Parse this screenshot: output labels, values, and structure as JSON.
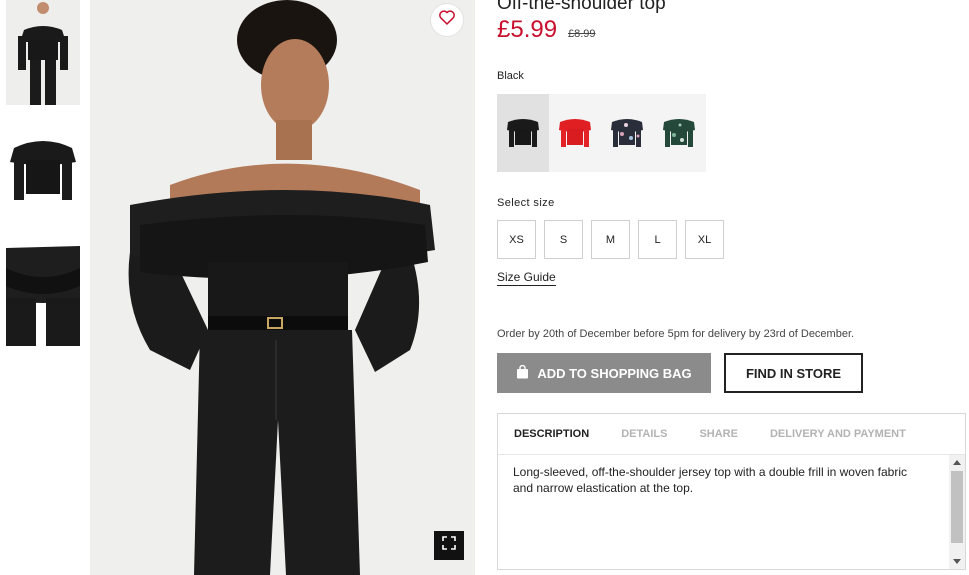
{
  "product": {
    "title": "Off-the-shoulder top",
    "price": "£5.99",
    "old_price": "£8.99",
    "color_label": "Black",
    "swatches": [
      {
        "name": "black",
        "color": "#1a1a1a"
      },
      {
        "name": "red",
        "color": "#e01f22"
      },
      {
        "name": "floral-print",
        "color": "#2a2e3a"
      },
      {
        "name": "green-print",
        "color": "#24483a"
      }
    ],
    "size_label": "Select size",
    "sizes": [
      "XS",
      "S",
      "M",
      "L",
      "XL"
    ],
    "size_guide": "Size Guide",
    "delivery_note": "Order by 20th of December before 5pm for delivery by 23rd of December.",
    "add_to_bag": "ADD TO SHOPPING BAG",
    "find_in_store": "FIND IN STORE"
  },
  "tabs": [
    {
      "label": "DESCRIPTION",
      "active": true
    },
    {
      "label": "DETAILS",
      "active": false
    },
    {
      "label": "SHARE",
      "active": false
    },
    {
      "label": "DELIVERY AND PAYMENT",
      "active": false
    }
  ],
  "description": "Long-sleeved, off-the-shoulder jersey top with a double frill in woven fabric and narrow elastication at the top.",
  "icons": {
    "favorite": "heart-icon",
    "zoom": "fullscreen-icon",
    "bag": "shopping-bag-icon"
  },
  "colors": {
    "price": "#c8102e",
    "add_button_bg": "#8b8b8b"
  }
}
